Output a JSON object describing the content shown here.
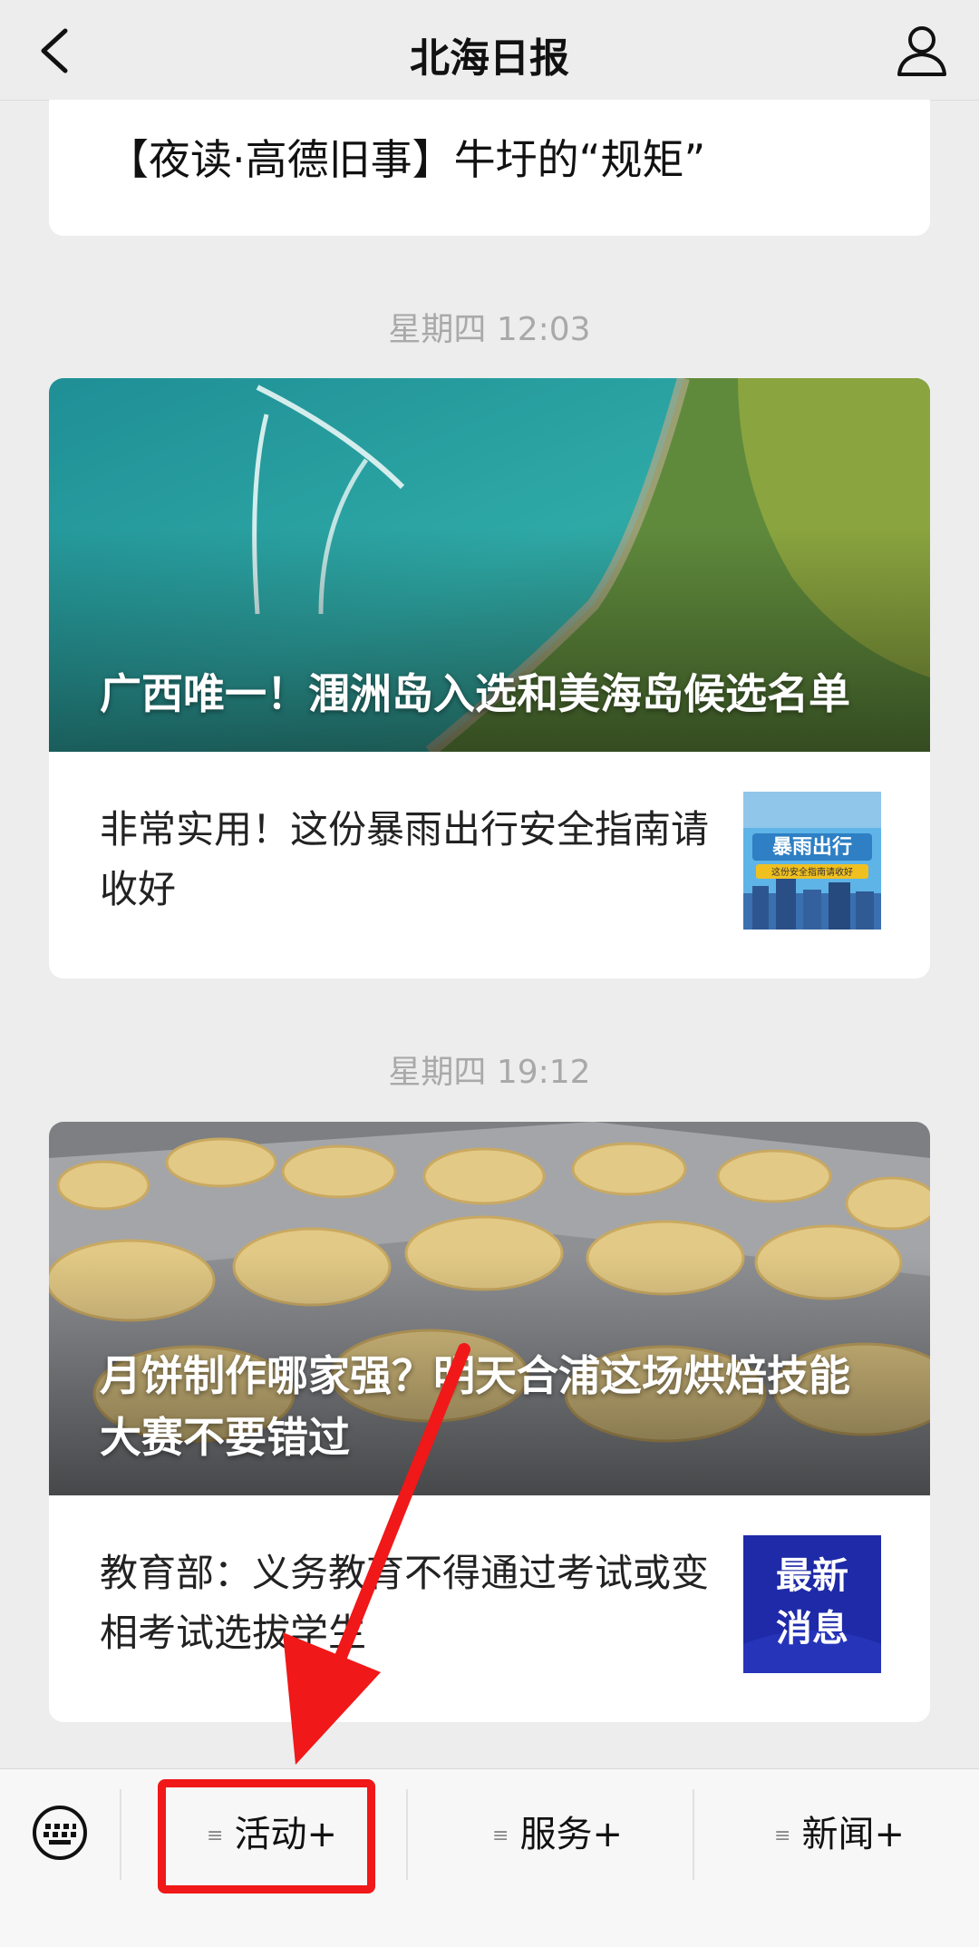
{
  "header": {
    "title": "北海日报"
  },
  "articles": {
    "top_title": "【夜读·高德旧事】牛圩的“规矩”",
    "group1": {
      "time": "星期四 12:03",
      "main_title": "广西唯一！涠洲岛入选和美海岛候选名单",
      "sub_title": "非常实用！这份暴雨出行安全指南请收好",
      "thumb_text": "暴雨出行",
      "thumb_caption": "这份安全指南请收好"
    },
    "group2": {
      "time": "星期四 19:12",
      "main_title": "月饼制作哪家强？明天合浦这场烘焙技能大赛不要错过",
      "sub_title": "教育部：义务教育不得通过考试或变相考试选拔学生",
      "thumb_text": "最新消息"
    }
  },
  "bottom_menu": {
    "items": [
      {
        "label": "活动+",
        "icon": "menu-lines-icon"
      },
      {
        "label": "服务+",
        "icon": "menu-lines-icon"
      },
      {
        "label": "新闻+",
        "icon": "menu-lines-icon"
      }
    ],
    "keyboard_icon": "keyboard-icon",
    "highlight_color": "#f01818"
  }
}
